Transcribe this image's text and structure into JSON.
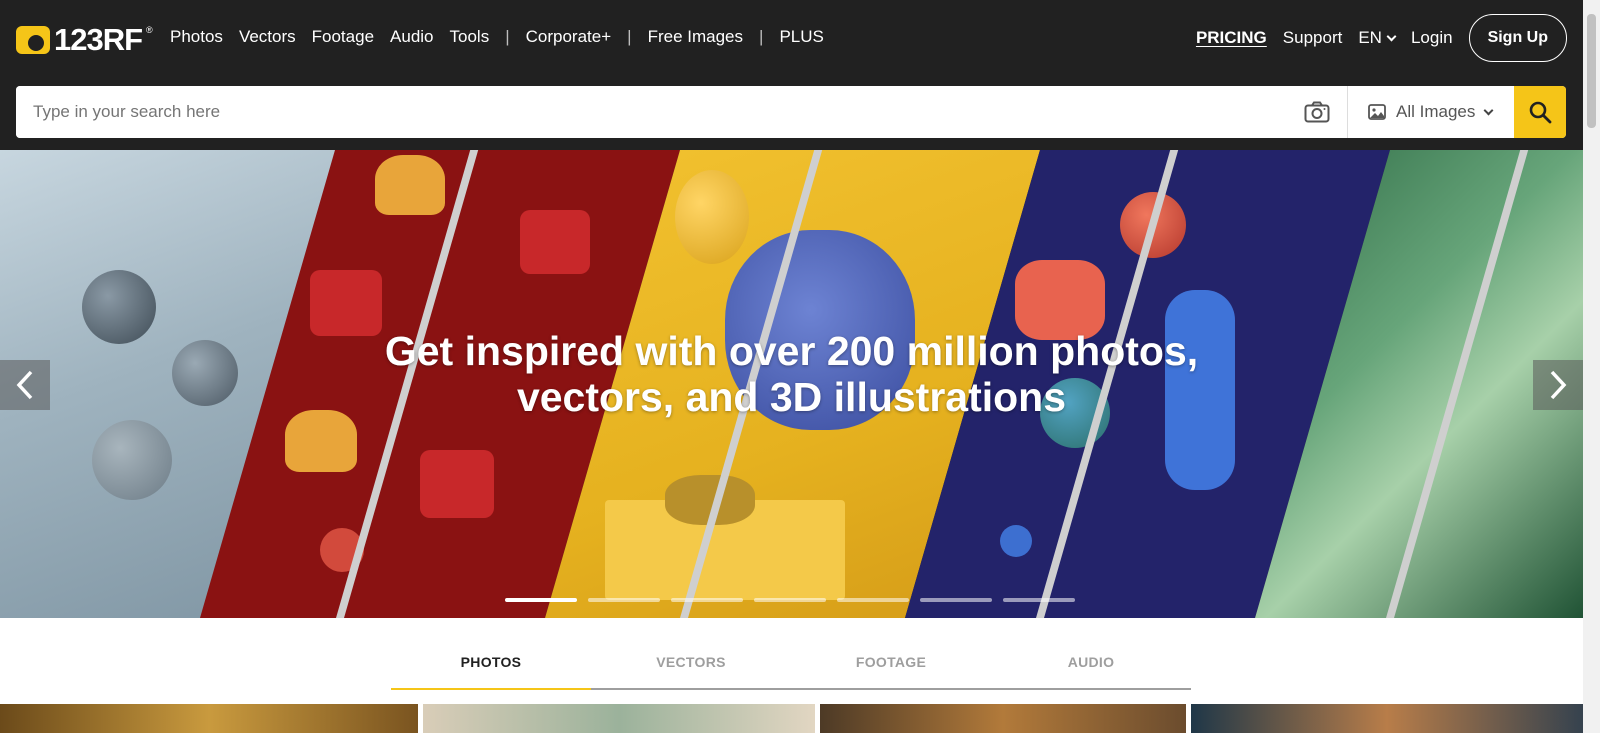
{
  "brand": {
    "name": "123RF",
    "reg": "®"
  },
  "nav": {
    "items": [
      "Photos",
      "Vectors",
      "Footage",
      "Audio",
      "Tools"
    ],
    "separator": "|",
    "corporate": "Corporate+",
    "free_images": "Free Images",
    "plus": "PLUS"
  },
  "right_nav": {
    "pricing": "PRICING",
    "support": "Support",
    "language": "EN",
    "login": "Login",
    "signup": "Sign Up"
  },
  "search": {
    "placeholder": "Type in your search here",
    "filter_label": "All Images"
  },
  "hero": {
    "title_line1": "Get inspired with over 200 million photos,",
    "title_line2": "vectors, and 3D illustrations",
    "slide_count": 7,
    "active_slide": 1
  },
  "tabs": [
    {
      "label": "PHOTOS",
      "active": true
    },
    {
      "label": "VECTORS",
      "active": false
    },
    {
      "label": "FOOTAGE",
      "active": false
    },
    {
      "label": "AUDIO",
      "active": false
    }
  ],
  "colors": {
    "header_bg": "#212121",
    "accent": "#f5c518"
  }
}
